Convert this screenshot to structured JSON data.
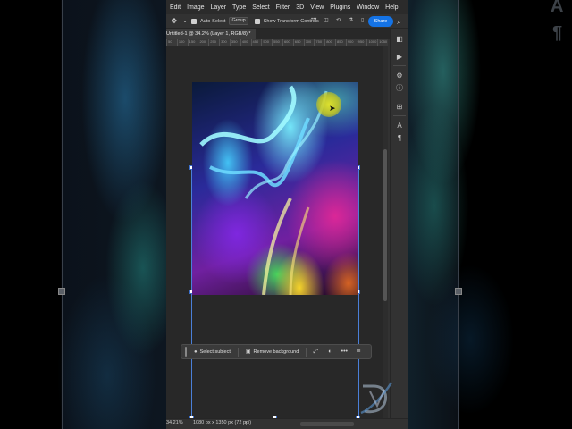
{
  "menubar": {
    "items": [
      "Edit",
      "Image",
      "Layer",
      "Type",
      "Select",
      "Filter",
      "3D",
      "View",
      "Plugins",
      "Window",
      "Help"
    ]
  },
  "optionsbar": {
    "move_icon": "move-tool-icon",
    "auto_select_label": "Auto-Select",
    "group_select": "Group",
    "show_transform_label": "Show Transform Controls",
    "share_label": "Share"
  },
  "document": {
    "tab_title": "Untitled-1 @ 34.2% (Layer 1, RGB/8) *"
  },
  "ruler": {
    "ticks": [
      "50",
      "100",
      "150",
      "200",
      "250",
      "300",
      "350",
      "400",
      "450",
      "500",
      "550",
      "600",
      "650",
      "700",
      "750",
      "800",
      "850",
      "900",
      "950",
      "1000",
      "1050"
    ]
  },
  "status": {
    "zoom": "34.21%",
    "dimensions": "1080 px x 1350 px (72 ppi)"
  },
  "contextual_taskbar": {
    "select_subject": "Select subject",
    "remove_background": "Remove background",
    "more": "•••"
  },
  "side_glyphs": {
    "top_right": "A",
    "pilcrow": "¶"
  },
  "colors": {
    "share_blue": "#1473e6",
    "transform_blue": "#4a7fd8",
    "cursor_highlight": "#e6e628"
  }
}
